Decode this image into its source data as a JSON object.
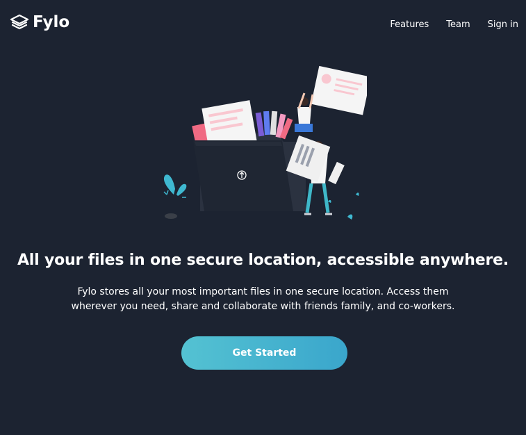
{
  "brand": {
    "name": "Fylo",
    "logo_icon": "layers-icon"
  },
  "nav": {
    "items": [
      {
        "label": "Features"
      },
      {
        "label": "Team"
      },
      {
        "label": "Sign in"
      }
    ]
  },
  "hero": {
    "illustration": "files-folder-illustration",
    "headline": "All your files in one secure location, accessible anywhere.",
    "description": "Fylo stores all your most important files in one secure location. Access them wherever you need, share and collaborate with friends family, and co-workers.",
    "cta_label": "Get Started"
  },
  "colors": {
    "background": "#1c2331",
    "cta_start": "#54c2d2",
    "cta_end": "#3aa6cc",
    "text": "#ffffff"
  }
}
